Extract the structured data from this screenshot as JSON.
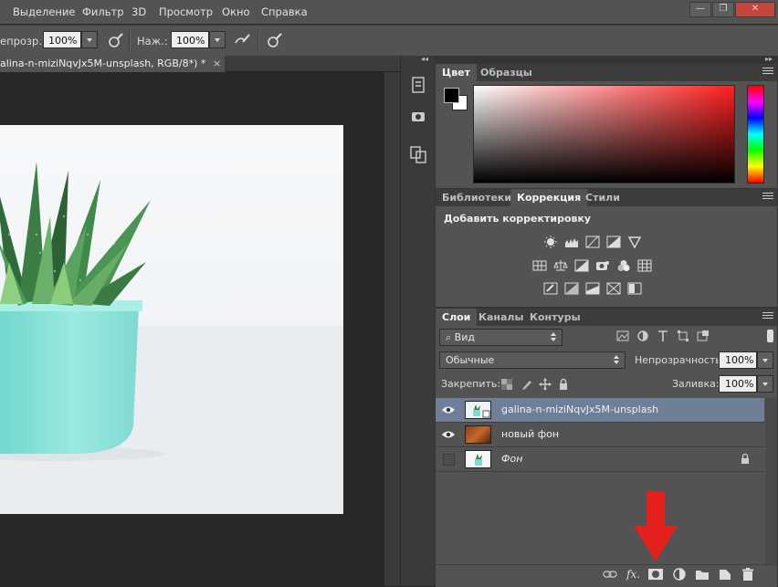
{
  "menu": {
    "items": [
      "Выделение",
      "Фильтр",
      "3D",
      "Просмотр",
      "Окно",
      "Справка"
    ],
    "window_minimize": "—",
    "window_restore": "❐",
    "window_close": "✕"
  },
  "options": {
    "opacity_label": "епрозр.:",
    "opacity_value": "100%",
    "pressure_label": "Наж.:",
    "pressure_value": "100%"
  },
  "document": {
    "tab_title": "alina-n-miziNqvJx5M-unsplash, RGB/8*) *",
    "tab_close": "×",
    "collapse_glyph": "◂◂"
  },
  "color_panel": {
    "tabs": [
      "Цвет",
      "Образцы"
    ],
    "foreground": "#000000",
    "background": "#ffffff",
    "hue": "#ff1f1f"
  },
  "adjust_panel": {
    "tabs": [
      "Библиотеки",
      "Коррекция",
      "Стили"
    ],
    "heading": "Добавить корректировку"
  },
  "layers_panel": {
    "tabs": [
      "Слои",
      "Каналы",
      "Контуры"
    ],
    "filter_kind": "Вид",
    "blend_mode": "Обычные",
    "opacity_label": "Непрозрачность:",
    "opacity_value": "100%",
    "lock_label": "Закрепить:",
    "fill_label": "Заливка:",
    "fill_value": "100%",
    "layers": [
      {
        "name": "galina-n-miziNqvJx5M-unsplash",
        "visible": true,
        "selected": true,
        "italic": false
      },
      {
        "name": "новый фон",
        "visible": true,
        "selected": false,
        "italic": false
      },
      {
        "name": "Фон",
        "visible": false,
        "selected": false,
        "italic": true
      }
    ],
    "fx_label": "fx."
  },
  "colors": {
    "selection": "#6f7f97",
    "highlight_arrow": "#e3201b"
  }
}
